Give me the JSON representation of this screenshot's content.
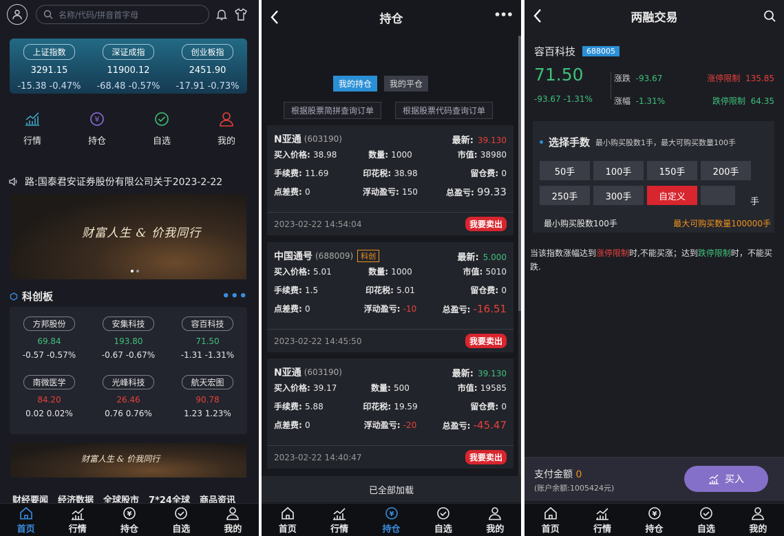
{
  "home": {
    "search_placeholder": "名称/代码/拼音首字母",
    "indices": [
      {
        "name": "上证指数",
        "value": "3291.15",
        "change": "-15.38  -0.47%"
      },
      {
        "name": "深证成指",
        "value": "11900.12",
        "change": "-68.48  -0.57%"
      },
      {
        "name": "创业板指",
        "value": "2451.90",
        "change": "-17.91  -0.73%"
      }
    ],
    "quick": [
      "行情",
      "持仓",
      "自选",
      "我的"
    ],
    "notice": "路:国泰君安证券股份有限公司关于2023-2-22",
    "banner_text": "财富人生 & 价我同行",
    "banner2_text": "财富人生 & 价我同行",
    "section_title": "科创板",
    "stocks": [
      {
        "name": "方邦股份",
        "price": "69.84",
        "change": "-0.57  -0.57%",
        "color": "#3ec07a"
      },
      {
        "name": "安集科技",
        "price": "193.80",
        "change": "-0.67  -0.67%",
        "color": "#3ec07a"
      },
      {
        "name": "容百科技",
        "price": "71.50",
        "change": "-1.31  -1.31%",
        "color": "#3ec07a"
      },
      {
        "name": "南微医学",
        "price": "84.20",
        "change": "0.02  0.02%",
        "color": "#e5413b"
      },
      {
        "name": "光峰科技",
        "price": "26.46",
        "change": "0.76  0.76%",
        "color": "#e5413b"
      },
      {
        "name": "航天宏图",
        "price": "90.78",
        "change": "1.23  1.23%",
        "color": "#e5413b"
      }
    ],
    "news_tabs": [
      "财经要闻",
      "经济数据",
      "全球股市",
      "7*24全球",
      "商品资讯"
    ]
  },
  "positions": {
    "title": "持仓",
    "seg_holding": "我的持仓",
    "seg_closed": "我的平仓",
    "query_by_abbr": "根据股票简拼查询订单",
    "query_by_code": "根据股票代码查询订单",
    "orders": [
      {
        "name": "N亚通",
        "code": "(603190)",
        "tag": "",
        "latest_label": "最新:",
        "latest": "39.130",
        "latest_color": "#e5413b",
        "buy_price": "38.98",
        "qty": "1000",
        "market_value": "38980",
        "fee": "11.69",
        "stamp_tax": "38.98",
        "overnight": "0",
        "spread": "0",
        "float_pl": "150",
        "float_pl_color": "#e8e8e8",
        "total_pl": "99.33",
        "total_pl_color": "#e8e8e8",
        "time": "2023-02-22 14:54:04"
      },
      {
        "name": "中国通号",
        "code": "(688009)",
        "tag": "科创",
        "latest_label": "最新:",
        "latest": "5.000",
        "latest_color": "#3ec07a",
        "buy_price": "5.01",
        "qty": "1000",
        "market_value": "5010",
        "fee": "1.5",
        "stamp_tax": "5.01",
        "overnight": "0",
        "spread": "0",
        "float_pl": "-10",
        "float_pl_color": "#e5413b",
        "total_pl": "-16.51",
        "total_pl_color": "#e5413b",
        "time": "2023-02-22 14:45:50"
      },
      {
        "name": "N亚通",
        "code": "(603190)",
        "tag": "",
        "latest_label": "最新:",
        "latest": "39.130",
        "latest_color": "#3ec07a",
        "buy_price": "39.17",
        "qty": "500",
        "market_value": "19585",
        "fee": "5.88",
        "stamp_tax": "19.59",
        "overnight": "0",
        "spread": "0",
        "float_pl": "-20",
        "float_pl_color": "#e5413b",
        "total_pl": "-45.47",
        "total_pl_color": "#e5413b",
        "time": "2023-02-22 14:40:47"
      }
    ],
    "labels": {
      "buy_price": "买入价格:",
      "qty": "数量:",
      "market_value": "市值:",
      "fee": "手续费:",
      "stamp_tax": "印花税:",
      "overnight": "留仓费:",
      "spread": "点差费:",
      "float_pl": "浮动盈亏:",
      "total_pl": "总盈亏:"
    },
    "sell_label": "我要卖出",
    "all_loaded": "已全部加载"
  },
  "margin": {
    "title": "两融交易",
    "stock_name": "容百科技",
    "stock_code": "688005",
    "price": "71.50",
    "change": "-93.67  -1.31%",
    "change_label": "涨跌",
    "change_value": "-93.67",
    "pct_label": "涨幅",
    "pct_value": "-1.31%",
    "limit_up_label": "涨停限制",
    "limit_up": "135.85",
    "limit_down_label": "跌停限制",
    "limit_down": "64.35",
    "select_title": "选择手数",
    "select_hint": "最小购买股数1手，最大可购买数量100手",
    "lots": [
      "50手",
      "100手",
      "150手",
      "200手",
      "250手",
      "300手",
      "自定义"
    ],
    "lot_unit": "手",
    "min_buy": "最小购买股数100手",
    "max_buy": "最大可购买数量100000手",
    "rule_p1": "当该指数涨幅达到",
    "rule_up": "涨停限制",
    "rule_p2": "时,不能买涨；达到",
    "rule_down": "跌停限制",
    "rule_p3": "时，不能买跌.",
    "pay_label": "支付金额",
    "pay_value": "0",
    "balance": "(账户余额:1005424元)",
    "buy_label": "买入"
  },
  "tabbar": [
    "首页",
    "行情",
    "持仓",
    "自选",
    "我的"
  ]
}
